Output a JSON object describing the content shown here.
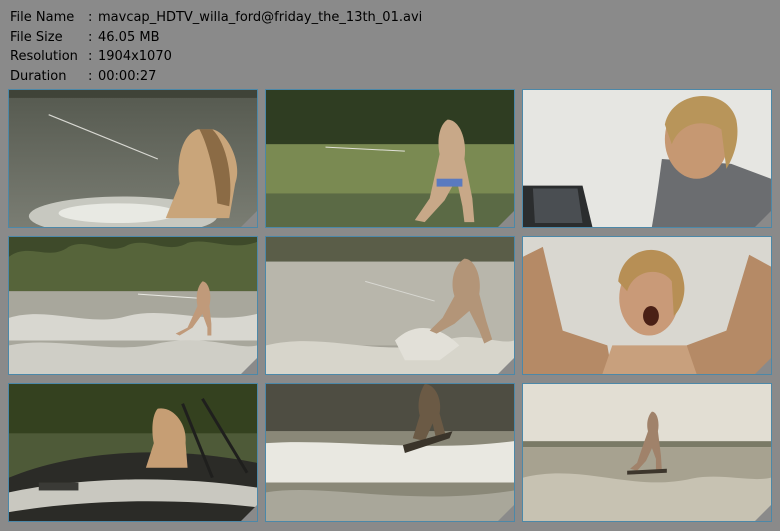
{
  "file_info": [
    {
      "label": "File Name",
      "sep": ":",
      "value": "mavcap_HDTV_willa_ford@friday_the_13th_01.avi"
    },
    {
      "label": "File Size",
      "sep": ":",
      "value": "46.05 MB"
    },
    {
      "label": "Resolution",
      "sep": ":",
      "value": "1904x1070"
    },
    {
      "label": "Duration",
      "sep": ":",
      "value": "00:00:27"
    }
  ],
  "thumbnails": [
    {
      "scene": "water-skier-rear-view"
    },
    {
      "scene": "skier-on-lake-trees"
    },
    {
      "scene": "driver-closeup"
    },
    {
      "scene": "wakeboarder-wide-shot"
    },
    {
      "scene": "blurred-skier-spray"
    },
    {
      "scene": "driver-arms-raised"
    },
    {
      "scene": "boat-deck-passenger"
    },
    {
      "scene": "wakeboard-jump"
    },
    {
      "scene": "wakeboarder-distant"
    }
  ],
  "colors": {
    "background": "#8a8a8a",
    "thumb_border": "#4c88a8",
    "text": "#000000"
  }
}
